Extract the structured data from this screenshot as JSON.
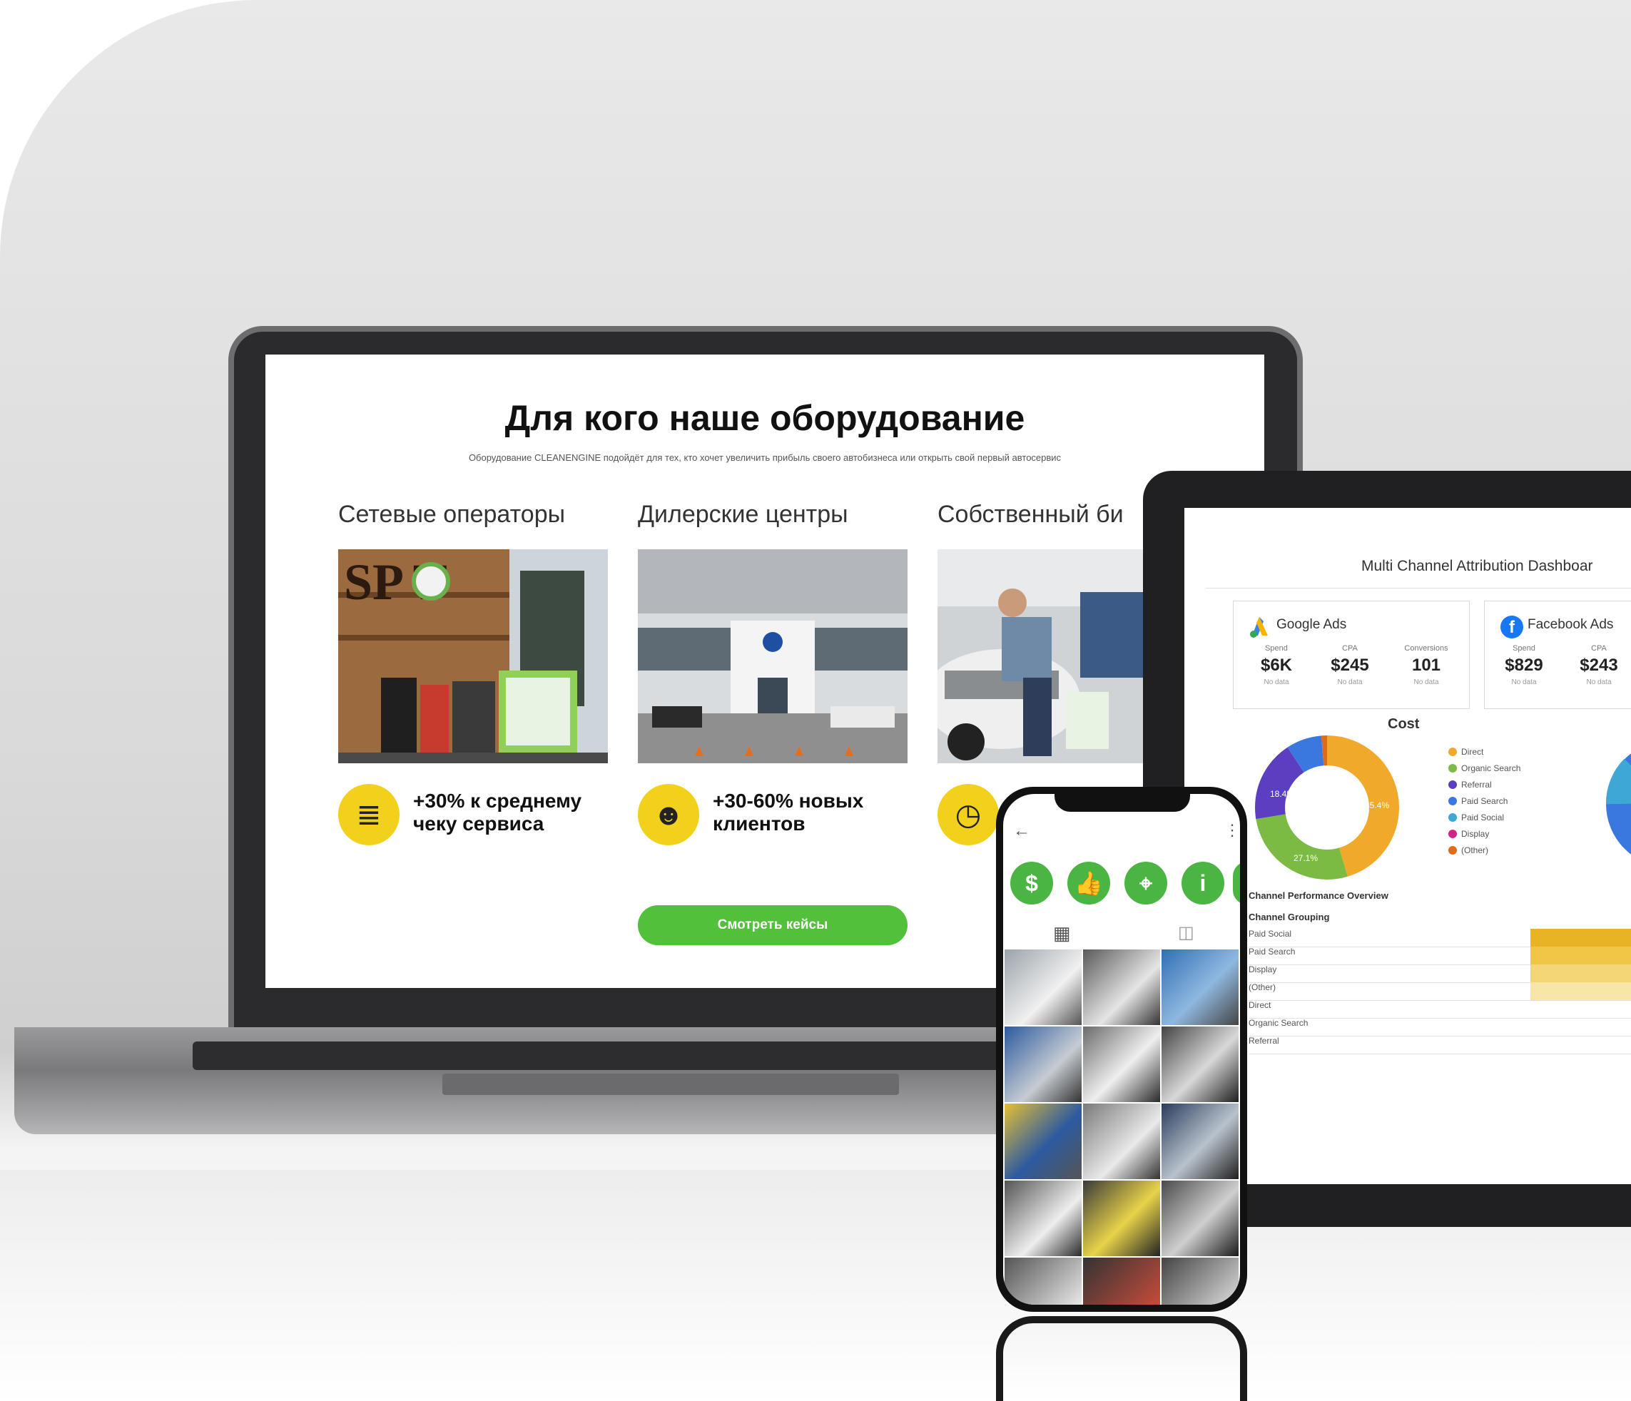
{
  "laptop": {
    "title": "Для кого наше оборудование",
    "subtitle": "Оборудование CLEANENGINE подойдёт для тех, кто хочет увеличить прибыль своего автобизнеса или открыть свой первый автосервис",
    "columns": [
      {
        "heading": "Сетевые операторы",
        "photo_text": "SP T",
        "feature": "+30% к среднему\nчеку сервиса",
        "icon": "receipt-icon"
      },
      {
        "heading": "Дилерские центры",
        "feature": "+30-60% новых\nклиентов",
        "icon": "people-icon"
      },
      {
        "heading": "Собственный би",
        "icon": "clock-parking-icon"
      }
    ],
    "cta_label": "Смотреть кейсы",
    "colors": {
      "accent_green": "#52c03b",
      "icon_yellow": "#f2d11d"
    }
  },
  "tablet": {
    "dashboard_title": "Multi Channel Attribution Dashboar",
    "cards": [
      {
        "name": "Google Ads",
        "icon": "google-ads-icon",
        "metrics": [
          {
            "label": "Spend",
            "value": "$6K",
            "sub": "No data"
          },
          {
            "label": "CPA",
            "value": "$245",
            "sub": "No data"
          },
          {
            "label": "Conversions",
            "value": "101",
            "sub": "No data"
          }
        ]
      },
      {
        "name": "Facebook Ads",
        "icon": "facebook-icon",
        "metrics": [
          {
            "label": "Spend",
            "value": "$829",
            "sub": "No data"
          },
          {
            "label": "CPA",
            "value": "$243",
            "sub": "No data"
          }
        ]
      }
    ],
    "cost_title": "Cost",
    "donut_labels": [
      "18.4%",
      "45.4%",
      "27.1%"
    ],
    "legend": [
      {
        "label": "Direct",
        "color": "#f0a92a"
      },
      {
        "label": "Organic Search",
        "color": "#7bbb43"
      },
      {
        "label": "Referral",
        "color": "#5b3fc0"
      },
      {
        "label": "Paid Search",
        "color": "#3a78e0"
      },
      {
        "label": "Paid Social",
        "color": "#3fa7d6"
      },
      {
        "label": "Display",
        "color": "#d4218a"
      },
      {
        "label": "(Other)",
        "color": "#e06a1c"
      }
    ],
    "performance_title": "Channel Performance Overview",
    "grouping_header": "Channel Grouping",
    "rows": [
      "Paid Social",
      "Paid Search",
      "Display",
      "(Other)",
      "Direct",
      "Organic Search",
      "Referral"
    ]
  },
  "phone": {
    "actions": [
      {
        "icon": "dollar-icon",
        "glyph": "$"
      },
      {
        "icon": "thumbs-up-icon",
        "glyph": "👍"
      },
      {
        "icon": "location-pin-icon",
        "glyph": "⌖"
      },
      {
        "icon": "info-icon",
        "glyph": "i"
      }
    ],
    "back_glyph": "←",
    "menu_glyph": "⋮",
    "grid_tab_glyph": "▦",
    "tag_tab_glyph": "◫"
  }
}
